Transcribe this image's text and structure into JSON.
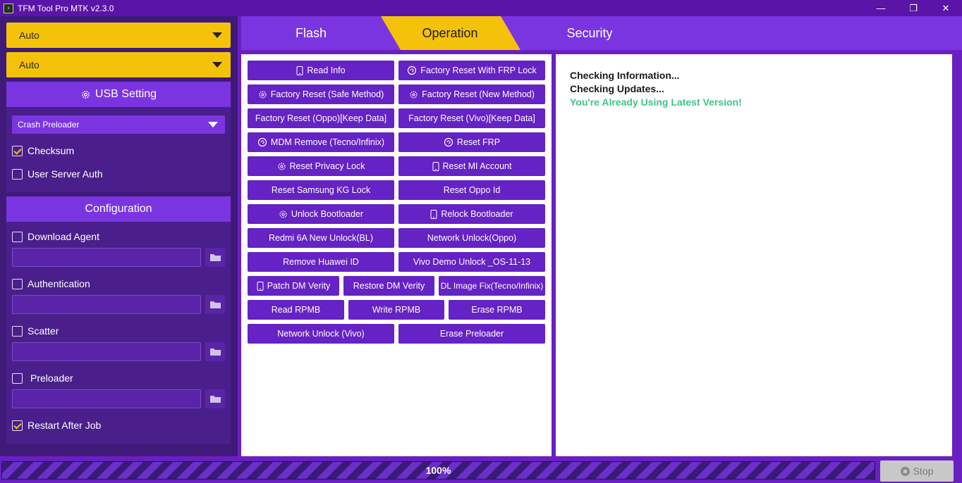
{
  "window": {
    "title": "TFM Tool Pro MTK v2.3.0",
    "controls": [
      "—",
      "❐",
      "✕"
    ]
  },
  "left": {
    "port_dropdown": "Auto",
    "mode_dropdown": "Auto",
    "usb_setting": {
      "title": "USB Setting",
      "method_dropdown": "Crash Preloader",
      "checksum": {
        "label": "Checksum",
        "checked": true
      },
      "user_server_auth": {
        "label": "User Server Auth",
        "checked": false
      }
    },
    "configuration": {
      "title": "Configuration",
      "download_agent": {
        "label": "Download Agent",
        "checked": false
      },
      "authentication": {
        "label": "Authentication",
        "checked": false
      },
      "scatter": {
        "label": "Scatter",
        "checked": false
      },
      "preloader": {
        "label": "Preloader",
        "checked": false
      },
      "restart_after_job": {
        "label": "Restart After Job",
        "checked": true
      }
    }
  },
  "tabs": {
    "flash": "Flash",
    "operation": "Operation",
    "security": "Security",
    "active": "Operation"
  },
  "operations": {
    "read_info": "Read Info",
    "factory_reset_frp": "Factory Reset With FRP Lock",
    "factory_reset_safe": "Factory Reset (Safe Method)",
    "factory_reset_new": "Factory Reset (New Method)",
    "factory_reset_oppo": "Factory Reset (Oppo)[Keep Data]",
    "factory_reset_vivo": "Factory Reset (Vivo)[Keep Data]",
    "mdm_remove": "MDM Remove (Tecno/Infinix)",
    "reset_frp": "Reset FRP",
    "reset_privacy_lock": "Reset Privacy Lock",
    "reset_mi_account": "Reset MI Account",
    "reset_samsung_kg": "Reset Samsung KG Lock",
    "reset_oppo_id": "Reset Oppo Id",
    "unlock_bootloader": "Unlock Bootloader",
    "relock_bootloader": "Relock Bootloader",
    "redmi_6a_unlock": "Redmi 6A New Unlock(BL)",
    "network_unlock_oppo": "Network Unlock(Oppo)",
    "remove_huawei_id": "Remove Huawei ID",
    "vivo_demo_unlock": "Vivo Demo Unlock _OS-11-13",
    "patch_dm_verity": "Patch DM Verity",
    "restore_dm_verity": "Restore DM Verity",
    "dl_image_fix": "DL Image Fix(Tecno/Infinix)",
    "read_rpmb": "Read RPMB",
    "write_rpmb": "Write RPMB",
    "erase_rpmb": "Erase RPMB",
    "network_unlock_vivo": "Network Unlock (Vivo)",
    "erase_preloader": "Erase Preloader"
  },
  "log": {
    "line1": "Checking Information...",
    "line2": "Checking Updates...",
    "line3": "You're Already Using Latest Version!",
    "ok_color": "#3cc58a"
  },
  "progress": {
    "label": "100%",
    "value": 100
  },
  "stop_button": "Stop",
  "colors": {
    "accent_purple": "#7b35e0",
    "accent_yellow": "#f5c20a",
    "button_purple": "#6522c4"
  }
}
